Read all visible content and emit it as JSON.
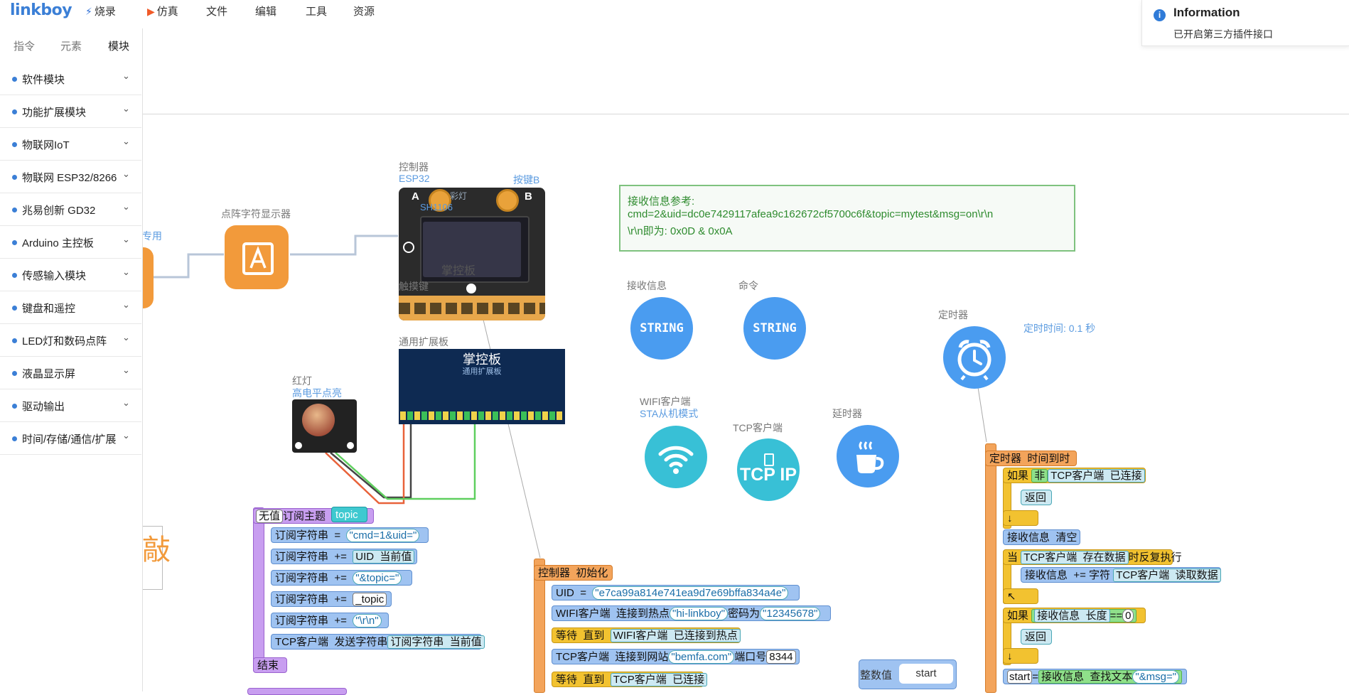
{
  "app": {
    "logo": "linkboy"
  },
  "menu": [
    {
      "icon": "lightning-icon",
      "label": "烧录"
    },
    {
      "icon": "play-icon",
      "label": "仿真"
    },
    {
      "label": "文件"
    },
    {
      "label": "编辑"
    },
    {
      "label": "工具"
    },
    {
      "label": "资源"
    }
  ],
  "notification": {
    "title": "Information",
    "body": "已开启第三方插件接口"
  },
  "sidebar": {
    "tabs": [
      "指令",
      "元素",
      "模块"
    ],
    "items": [
      "软件模块",
      "功能扩展模块",
      "物联网IoT",
      "物联网 ESP32/8266",
      "兆易创新 GD32",
      "Arduino 主控板",
      "传感输入模块",
      "键盘和遥控",
      "LED灯和数码点阵",
      "液晶显示屏",
      "驱动输出",
      "时间/存储/通信/扩展"
    ]
  },
  "canvas": {
    "partial_label": "专用",
    "partial_glyph": "敲",
    "matrix_label": "点阵字符显示器",
    "controller_label": "控制器",
    "controller_sub": "ESP32",
    "btn_b_label": "按键B",
    "color_light_label": "彩灯",
    "rgb_label": "SH1106",
    "touch_label": "触摸键",
    "board_brand": "掌控板",
    "ext_label": "通用扩展板",
    "ext_title": "掌控板",
    "ext_sub": "通用扩展板",
    "red_led_label": "红灯",
    "red_led_sub": "高电平点亮",
    "recv_label": "接收信息",
    "cmd_label": "命令",
    "string_text": "STRING",
    "timer_label": "定时器",
    "timer_time": "定时时间: 0.1 秒",
    "wifi_label": "WIFI客户端",
    "wifi_sub": "STA从机模式",
    "tcp_label": "TCP客户端",
    "tcp_text": "TCP IP",
    "delay_label": "延时器",
    "info_title": "接收信息参考:",
    "info_line1": "cmd=2&uid=dc0e7429117afea9c162672cf5700c6f&topic=mytest&msg=on\\r\\n",
    "info_line2": "\\r\\n即为: 0x0D & 0x0A"
  },
  "blocks_sub": {
    "none": "无值",
    "title": "订阅主题",
    "topic": "topic",
    "row1_a": "订阅字符串",
    "row1_op": "=",
    "row1_val": "\"cmd=1&uid=\"",
    "row2_a": "订阅字符串",
    "row2_op": "+=",
    "row2_b": "UID",
    "row2_c": "当前值",
    "row3_a": "订阅字符串",
    "row3_op": "+=",
    "row3_val": "\"&topic=\"",
    "row4_a": "订阅字符串",
    "row4_op": "+=",
    "row4_val": "_topic",
    "row5_a": "订阅字符串",
    "row5_op": "+=",
    "row5_val": "\"\\r\\n\"",
    "row6_a": "TCP客户端",
    "row6_b": "发送字符串",
    "row6_c": "订阅字符串",
    "row6_d": "当前值",
    "end": "结束"
  },
  "blocks_init": {
    "head_a": "控制器",
    "head_b": "初始化",
    "uid": "UID",
    "uid_op": "=",
    "uid_val": "\"e7ca99a814e741ea9d7e69bffa834a4e\"",
    "wifi_a": "WIFI客户端",
    "wifi_b": "连接到热点",
    "wifi_ssid": "\"hi-linkboy\"",
    "wifi_c": "密码为",
    "wifi_pwd": "\"12345678\"",
    "wait1_a": "等待",
    "wait1_b": "直到",
    "wait1_c": "WIFI客户端",
    "wait1_d": "已连接到热点",
    "tcp_a": "TCP客户端",
    "tcp_b": "连接到网站",
    "tcp_host": "\"bemfa.com\"",
    "tcp_c": "端口号",
    "tcp_port": "8344",
    "wait2_a": "等待",
    "wait2_b": "直到",
    "wait2_c": "TCP客户端",
    "wait2_d": "已连接"
  },
  "blocks_int": {
    "label": "整数值",
    "value": "start"
  },
  "blocks_timer": {
    "head_a": "定时器",
    "head_b": "时间到时",
    "if1": "如果",
    "not": "非",
    "if1_a": "TCP客户端",
    "if1_b": "已连接",
    "ret1": "返回",
    "clr_a": "接收信息",
    "clr_b": "清空",
    "while": "当",
    "while_a": "TCP客户端",
    "while_b": "存在数据",
    "while_c": "时反复执行",
    "app_a": "接收信息",
    "app_op": "+= 字符",
    "app_b": "TCP客户端",
    "app_c": "读取数据",
    "if2": "如果",
    "if2_a": "接收信息",
    "if2_b": "长度",
    "if2_op": "==",
    "if2_val": "0",
    "ret2": "返回",
    "start": "start",
    "eq": "=",
    "find_a": "接收信息",
    "find_b": "查找文本",
    "find_val": "\"&msg=\""
  },
  "colors": {
    "accent": "#3b7fd6",
    "circle": "#4a9cf0",
    "teal": "#38c0d6",
    "orange": "#f29a3b"
  }
}
